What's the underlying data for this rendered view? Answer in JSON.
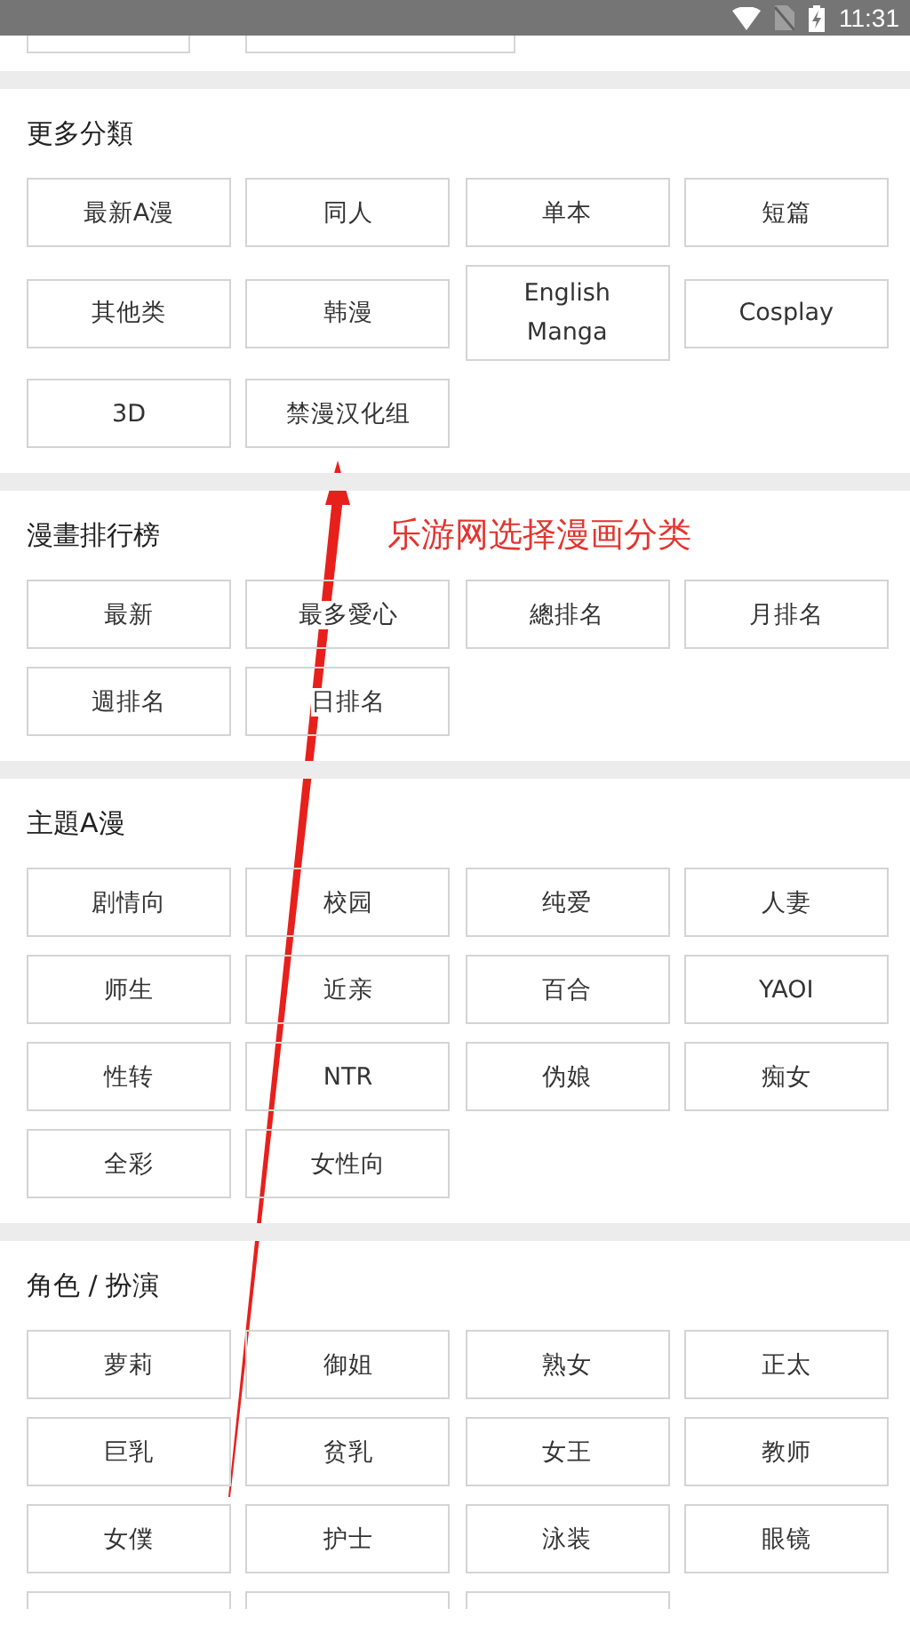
{
  "status_bar": {
    "time": "11:31"
  },
  "sections": [
    {
      "title": "更多分類",
      "items": [
        "最新A漫",
        "同人",
        "单本",
        "短篇",
        "其他类",
        "韩漫",
        "English Manga",
        "Cosplay",
        "3D",
        "禁漫汉化组"
      ]
    },
    {
      "title": "漫畫排行榜",
      "items": [
        "最新",
        "最多愛心",
        "總排名",
        "月排名",
        "週排名",
        "日排名"
      ]
    },
    {
      "title": "主題A漫",
      "items": [
        "剧情向",
        "校园",
        "纯爱",
        "人妻",
        "师生",
        "近亲",
        "百合",
        "YAOI",
        "性转",
        "NTR",
        "伪娘",
        "痴女",
        "全彩",
        "女性向"
      ]
    },
    {
      "title": "角色 / 扮演",
      "items": [
        "萝莉",
        "御姐",
        "熟女",
        "正太",
        "巨乳",
        "贫乳",
        "女王",
        "教师",
        "女僕",
        "护士",
        "泳装",
        "眼镜"
      ]
    }
  ],
  "annotation": {
    "text": "乐游网选择漫画分类"
  }
}
